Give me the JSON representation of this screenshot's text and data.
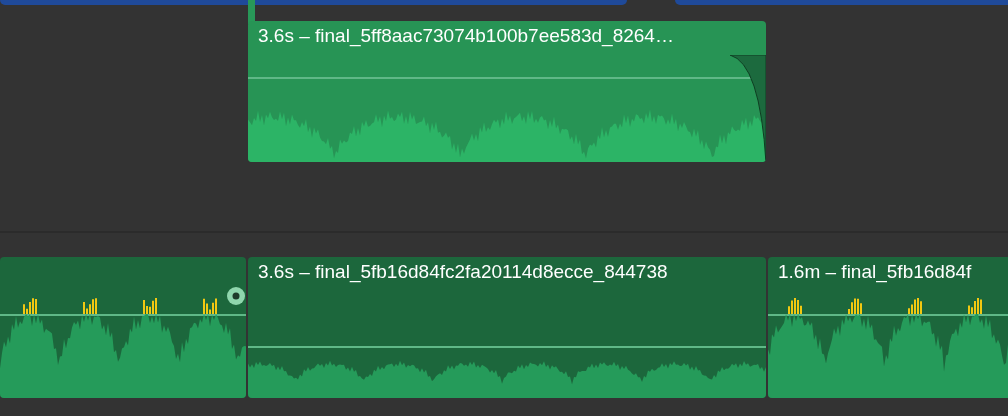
{
  "timeline": {
    "connected_clips": [
      {
        "title": "3.6s – final_5ff8aac73074b100b7ee583d_8264…",
        "fade_out": true,
        "peaking": false
      }
    ],
    "primary_clips": [
      {
        "marker": true,
        "fade_out": false,
        "peaking": true
      },
      {
        "title": "3.6s – final_5fb16d84fc2fa20114d8ecce_844738",
        "marker": false,
        "fade_out": false,
        "peaking": false
      },
      {
        "title": "1.6m – final_5fb16d84f",
        "marker": false,
        "fade_out": false,
        "peaking": true
      }
    ]
  }
}
